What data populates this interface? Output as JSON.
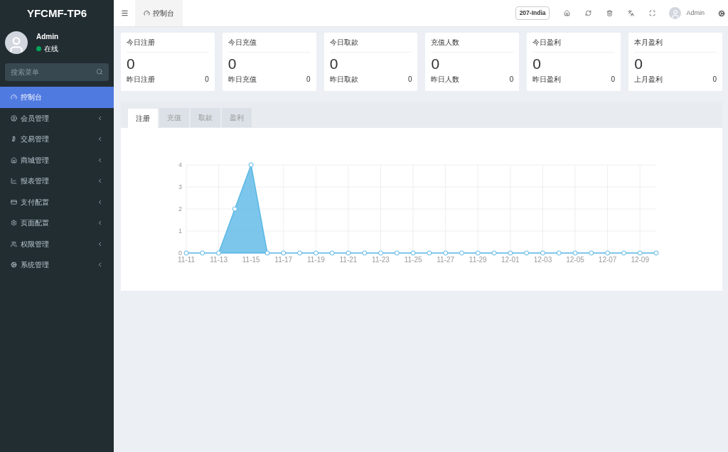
{
  "sidebar": {
    "logo": "YFCMF-TP6",
    "user": {
      "name": "Admin",
      "status": "在线"
    },
    "search": {
      "placeholder": "搜索菜单"
    },
    "items": [
      {
        "label": "控制台",
        "selected": true,
        "expandable": false
      },
      {
        "label": "会员管理",
        "selected": false,
        "expandable": true
      },
      {
        "label": "交易管理",
        "selected": false,
        "expandable": true
      },
      {
        "label": "商城管理",
        "selected": false,
        "expandable": true
      },
      {
        "label": "报表管理",
        "selected": false,
        "expandable": true
      },
      {
        "label": "支付配置",
        "selected": false,
        "expandable": true
      },
      {
        "label": "页面配置",
        "selected": false,
        "expandable": true
      },
      {
        "label": "权限管理",
        "selected": false,
        "expandable": true
      },
      {
        "label": "系统管理",
        "selected": false,
        "expandable": true
      }
    ]
  },
  "header": {
    "tab": "控制台",
    "badge": "207-India",
    "user": "Admin"
  },
  "stats": [
    {
      "title": "今日注册",
      "value": "0",
      "sub_label": "昨日注册",
      "sub_value": "0"
    },
    {
      "title": "今日充值",
      "value": "0",
      "sub_label": "昨日充值",
      "sub_value": "0"
    },
    {
      "title": "今日取款",
      "value": "0",
      "sub_label": "昨日取款",
      "sub_value": "0"
    },
    {
      "title": "充值人数",
      "value": "0",
      "sub_label": "昨日人数",
      "sub_value": "0"
    },
    {
      "title": "今日盈利",
      "value": "0",
      "sub_label": "昨日盈利",
      "sub_value": "0"
    },
    {
      "title": "本月盈利",
      "value": "0",
      "sub_label": "上月盈利",
      "sub_value": "0"
    }
  ],
  "chart_panel": {
    "tabs": [
      {
        "label": "注册",
        "selected": true
      },
      {
        "label": "充值",
        "selected": false
      },
      {
        "label": "取款",
        "selected": false
      },
      {
        "label": "盈利",
        "selected": false
      }
    ],
    "chart_data": {
      "type": "area",
      "categories": [
        "11-11",
        null,
        "11-13",
        null,
        "11-15",
        null,
        "11-17",
        null,
        "11-19",
        null,
        "11-21",
        null,
        "11-23",
        null,
        "11-25",
        null,
        "11-27",
        null,
        "11-29",
        null,
        "12-01",
        null,
        "12-03",
        null,
        "12-05",
        null,
        "12-07",
        null,
        "12-09",
        null
      ],
      "grid": true,
      "series": [
        {
          "color": "#5bb8e6",
          "values": [
            0,
            0,
            0,
            2,
            4,
            0,
            0,
            0,
            0,
            0,
            0,
            0,
            0,
            0,
            0,
            0,
            0,
            0,
            0,
            0,
            0,
            0,
            0,
            0,
            0,
            0,
            0,
            0,
            0,
            0
          ]
        }
      ],
      "ylim": [
        0,
        4
      ],
      "yticks": [
        0,
        1,
        2,
        3,
        4
      ]
    }
  }
}
